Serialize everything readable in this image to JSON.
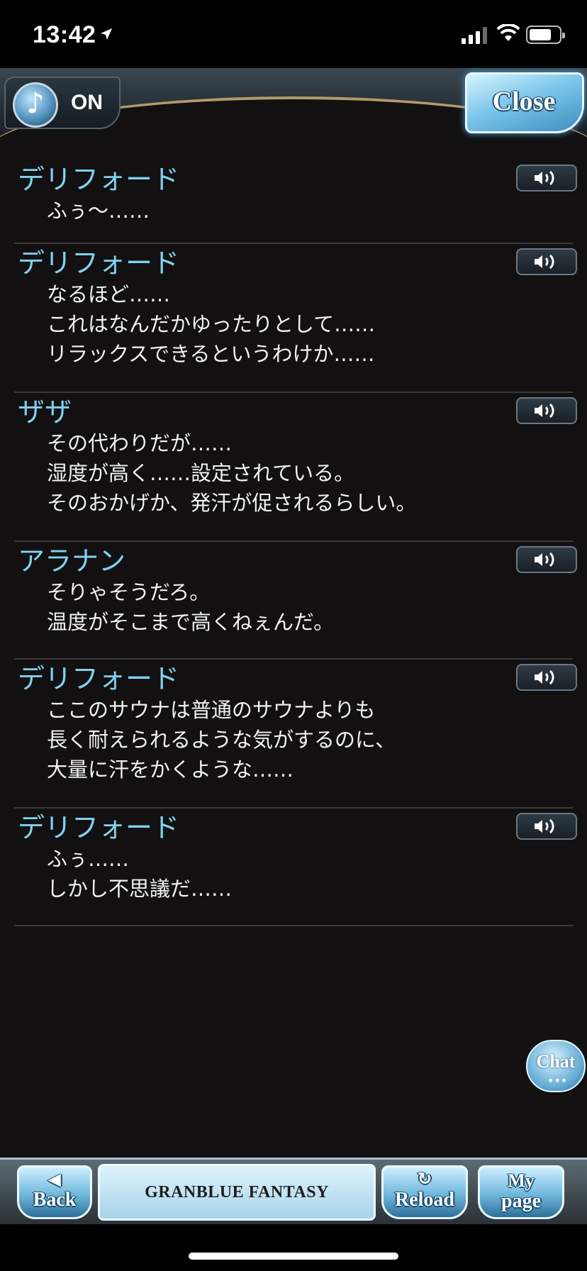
{
  "status_bar": {
    "time": "13:42"
  },
  "header": {
    "bgm_label": "ON",
    "close_label": "Close"
  },
  "log_entries": [
    {
      "speaker": "デリフォード",
      "lines": [
        "ふぅ～……"
      ]
    },
    {
      "speaker": "デリフォード",
      "lines": [
        "なるほど……",
        "これはなんだかゆったりとして……",
        "リラックスできるというわけか……"
      ]
    },
    {
      "speaker": "ザザ",
      "lines": [
        "その代わりだが……",
        "湿度が高く……設定されている。",
        "そのおかげか、発汗が促されるらしい。"
      ]
    },
    {
      "speaker": "アラナン",
      "lines": [
        "そりゃそうだろ。",
        "温度がそこまで高くねぇんだ。"
      ]
    },
    {
      "speaker": "デリフォード",
      "lines": [
        "ここのサウナは普通のサウナよりも",
        "長く耐えられるような気がするのに、",
        "大量に汗をかくような……"
      ]
    },
    {
      "speaker": "デリフォード",
      "lines": [
        "ふぅ……",
        "しかし不思議だ……"
      ]
    }
  ],
  "chat_button": {
    "label": "Chat"
  },
  "bottom_nav": {
    "back_label": "Back",
    "logo_text": "GRANBLUE FANTASY",
    "reload_label": "Reload",
    "mypage_line1": "My",
    "mypage_line2": "page"
  },
  "colors": {
    "speaker": "#7fd1ee",
    "background": "#121011",
    "accent": "#6fb7dd"
  }
}
